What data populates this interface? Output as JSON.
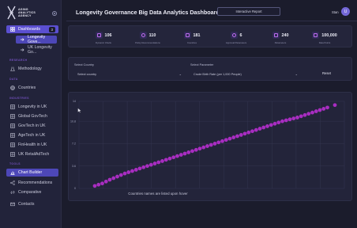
{
  "brand": {
    "name": "AGING ANALYTICS AGENCY"
  },
  "header": {
    "title": "Longevity Governance Big Data Analytics Dashboard",
    "report_button": "Interactive Report",
    "user": "Stan",
    "avatar_initial": "U"
  },
  "sidebar": {
    "dashboards": {
      "label": "Dashboards",
      "badge": "3"
    },
    "dash_items": [
      {
        "label": "Longevity Gove..."
      },
      {
        "label": "UK Longevity Go..."
      }
    ],
    "section_research": "RESEARCH",
    "methodology": "Methodology",
    "section_data": "DATA",
    "countries": "Countries",
    "section_industries": "INDUSTRIES",
    "industries": [
      {
        "label": "Longevity in UK"
      },
      {
        "label": "Global GovTech"
      },
      {
        "label": "GovTech in UK"
      },
      {
        "label": "AgeTech in UK"
      },
      {
        "label": "FinHealth in UK"
      },
      {
        "label": "UK RetailAdTech"
      }
    ],
    "section_tools": "TOOLS",
    "tools": [
      {
        "label": "Chart Builder"
      },
      {
        "label": "Recommendations"
      },
      {
        "label": "Comparative"
      }
    ],
    "contacts": "Contacts"
  },
  "stats": [
    {
      "value": "106",
      "label": "Dynamic Charts"
    },
    {
      "value": "110",
      "label": "Policy Recommendations"
    },
    {
      "value": "181",
      "label": "Countries"
    },
    {
      "value": "6",
      "label": "Approval Parameters"
    },
    {
      "value": "240",
      "label": "Parameters"
    },
    {
      "value": "100,000",
      "label": "Data Points"
    }
  ],
  "filters": {
    "country_label": "Select Country",
    "country_value": "Select country",
    "param_label": "Select Parameter",
    "param_value": "Crude Birth Rate (per 1,000 People)",
    "reset": "Reset"
  },
  "chart_data": {
    "type": "scatter",
    "y_ticks": [
      "0",
      "3.6",
      "7.2",
      "10.8",
      "14"
    ],
    "ylim": [
      0,
      14
    ],
    "y_values": [
      0.4,
      0.8,
      1.4,
      1.9,
      2.4,
      2.8,
      3.2,
      3.6,
      4.0,
      4.4,
      4.8,
      5.2,
      5.6,
      6.0,
      6.4,
      6.8,
      7.2,
      7.6,
      8.0,
      8.4,
      8.8,
      9.2,
      9.6,
      10.0,
      10.4,
      10.8,
      11.1,
      11.4,
      11.8,
      12.2,
      12.6,
      13.0,
      13.4
    ],
    "note": "Countries names are listed upon hover",
    "point_color": "#b02ec8",
    "grid": true
  }
}
